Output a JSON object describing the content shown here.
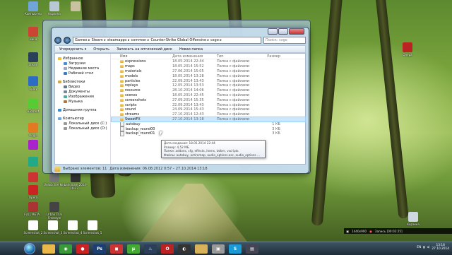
{
  "desktop_icons": [
    {
      "label": "Компьютер",
      "color": "#6fa5d8"
    },
    {
      "label": "Корзина",
      "color": "#b8c8d4"
    },
    {
      "label": "",
      "color": "#c8c2a0"
    },
    {
      "label": "Нина",
      "color": "#c43"
    },
    {
      "label": "Steam",
      "color": "#2a3f5a"
    },
    {
      "label": "Uplay",
      "color": "#2c6cc2"
    },
    {
      "label": "uTorrent",
      "color": "#5c3"
    },
    {
      "label": "Origin",
      "color": "#e27a22"
    },
    {
      "label": "",
      "color": "#a2c"
    },
    {
      "label": "",
      "color": "#2a8"
    },
    {
      "label": "",
      "color": "#c33"
    },
    {
      "label": "Opera",
      "color": "#c22"
    },
    {
      "label": "Unlock the Key",
      "color": "#777"
    },
    {
      "label": "bandicam 2014-10-27...",
      "color": "#333"
    },
    {
      "label": "FULL META...",
      "color": "#a33"
    },
    {
      "label": "Urban Trial Freestyle",
      "color": "#444"
    },
    {
      "label": "Screenshot_2",
      "color": "#fff"
    },
    {
      "label": "Screenshot_3",
      "color": "#fff"
    },
    {
      "label": "Screenshot_4",
      "color": "#fff"
    },
    {
      "label": "Screenshot_5",
      "color": "#fff"
    },
    {
      "label": "Опера",
      "color": "#b22"
    },
    {
      "label": "Корзина",
      "color": "#cfd8e0"
    }
  ],
  "explorer": {
    "breadcrumb": [
      "Games",
      "Steam",
      "steamapps",
      "common",
      "Counter-Strike Global Offensive",
      "csgo"
    ],
    "search_placeholder": "Поиск: csgo",
    "toolbar": [
      "Упорядочить ▾",
      "Открыть",
      "Записать на оптический диск",
      "Новая папка"
    ],
    "nav": [
      {
        "label": "Избранное",
        "level": 0,
        "color": "#e9c23a"
      },
      {
        "label": "Загрузки",
        "level": 1,
        "color": "#4a8fd0"
      },
      {
        "label": "Недавние места",
        "level": 1,
        "color": "#9ab"
      },
      {
        "label": "Рабочий стол",
        "level": 1,
        "color": "#3b7cc0"
      },
      {
        "label": "",
        "level": -1
      },
      {
        "label": "Библиотеки",
        "level": 0,
        "color": "#d4a84a"
      },
      {
        "label": "Видео",
        "level": 1,
        "color": "#678"
      },
      {
        "label": "Документы",
        "level": 1,
        "color": "#789"
      },
      {
        "label": "Изображения",
        "level": 1,
        "color": "#5a9"
      },
      {
        "label": "Музыка",
        "level": 1,
        "color": "#a74"
      },
      {
        "label": "",
        "level": -1
      },
      {
        "label": "Домашняя группа",
        "level": 0,
        "color": "#3a8cc8"
      },
      {
        "label": "",
        "level": -1
      },
      {
        "label": "Компьютер",
        "level": 0,
        "color": "#6fa5d8"
      },
      {
        "label": "Локальный диск (C:)",
        "level": 1,
        "color": "#999"
      },
      {
        "label": "Локальный диск (D:)",
        "level": 1,
        "color": "#999"
      }
    ],
    "columns": [
      "Имя",
      "Дата изменения",
      "Тип",
      "Размер"
    ],
    "files": [
      {
        "name": "expressions",
        "date": "18.05.2014 22:44",
        "type": "Папка с файлами",
        "size": "",
        "kind": "folder"
      },
      {
        "name": "maps",
        "date": "18.05.2014 15:52",
        "type": "Папка с файлами",
        "size": "",
        "kind": "folder"
      },
      {
        "name": "materials",
        "date": "27.06.2014 15:05",
        "type": "Папка с файлами",
        "size": "",
        "kind": "folder"
      },
      {
        "name": "models",
        "date": "18.05.2014 13:28",
        "type": "Папка с файлами",
        "size": "",
        "kind": "folder"
      },
      {
        "name": "particles",
        "date": "22.09.2014 13:43",
        "type": "Папка с файлами",
        "size": "",
        "kind": "folder"
      },
      {
        "name": "replays",
        "date": "12.05.2014 13:53",
        "type": "Папка с файлами",
        "size": "",
        "kind": "folder"
      },
      {
        "name": "resource",
        "date": "28.10.2014 14:06",
        "type": "Папка с файлами",
        "size": "",
        "kind": "folder"
      },
      {
        "name": "scenes",
        "date": "18.05.2014 22:45",
        "type": "Папка с файлами",
        "size": "",
        "kind": "folder"
      },
      {
        "name": "screenshots",
        "date": "27.09.2014 15:35",
        "type": "Папка с файлами",
        "size": "",
        "kind": "folder"
      },
      {
        "name": "scripts",
        "date": "22.09.2014 13:43",
        "type": "Папка с файлами",
        "size": "",
        "kind": "folder"
      },
      {
        "name": "sound",
        "date": "24.09.2014 15:43",
        "type": "Папка с файлами",
        "size": "",
        "kind": "folder"
      },
      {
        "name": "streams",
        "date": "27.10.2014 12:43",
        "type": "Папка с файлами",
        "size": "",
        "kind": "folder"
      },
      {
        "name": "SweetFX",
        "date": "27.10.2014 13:18",
        "type": "Папка с файлами",
        "size": "",
        "kind": "folder",
        "selected": true
      },
      {
        "name": "autobuy",
        "date": "",
        "type": "",
        "size": "1 КБ",
        "kind": "file"
      },
      {
        "name": "backup_round00",
        "date": "",
        "type": "",
        "size": "3 КБ",
        "kind": "file"
      },
      {
        "name": "backup_round01",
        "date": "",
        "type": "",
        "size": "3 КБ",
        "kind": "file"
      }
    ],
    "status_count": "Выбрано элементов: 11",
    "status_dates": "Дата изменения: 06.08.2012 0:57 – 27.10.2014 13:18"
  },
  "tooltip": [
    "Дата создания: 18.05.2014 22:44",
    "Размер: 4,52 МБ",
    "Папки: addons, cfg, effects, items, talker, vscripts",
    "Файлы: autobuy, actiremap, audio_options.osc, audio_options ..."
  ],
  "recording": {
    "resolution": "1440x900",
    "label": "Запись [00:02:25]"
  },
  "taskbar": {
    "apps": [
      {
        "name": "explorer",
        "color": "#e8b84a",
        "glyph": ""
      },
      {
        "name": "chrome",
        "color": "#3a9a3a",
        "glyph": "◉"
      },
      {
        "name": "bandicam",
        "color": "#c22",
        "glyph": "●"
      },
      {
        "name": "photoshop",
        "color": "#1b3f73",
        "glyph": "Ps"
      },
      {
        "name": "app5",
        "color": "#c33",
        "glyph": "◼"
      },
      {
        "name": "utorrent",
        "color": "#4a3",
        "glyph": "µ"
      },
      {
        "name": "steam",
        "color": "#2a3f5a",
        "glyph": "♨"
      },
      {
        "name": "opera",
        "color": "#b22",
        "glyph": "O"
      },
      {
        "name": "app9",
        "color": "#333",
        "glyph": "◐"
      },
      {
        "name": "folder",
        "color": "#d8b25a",
        "glyph": ""
      },
      {
        "name": "app11",
        "color": "#999",
        "glyph": "▣"
      },
      {
        "name": "skype",
        "color": "#1b9ad6",
        "glyph": "S"
      },
      {
        "name": "app13",
        "color": "#445",
        "glyph": "▤"
      }
    ],
    "lang": "EN",
    "time": "13:18",
    "date": "27.10.2014"
  }
}
